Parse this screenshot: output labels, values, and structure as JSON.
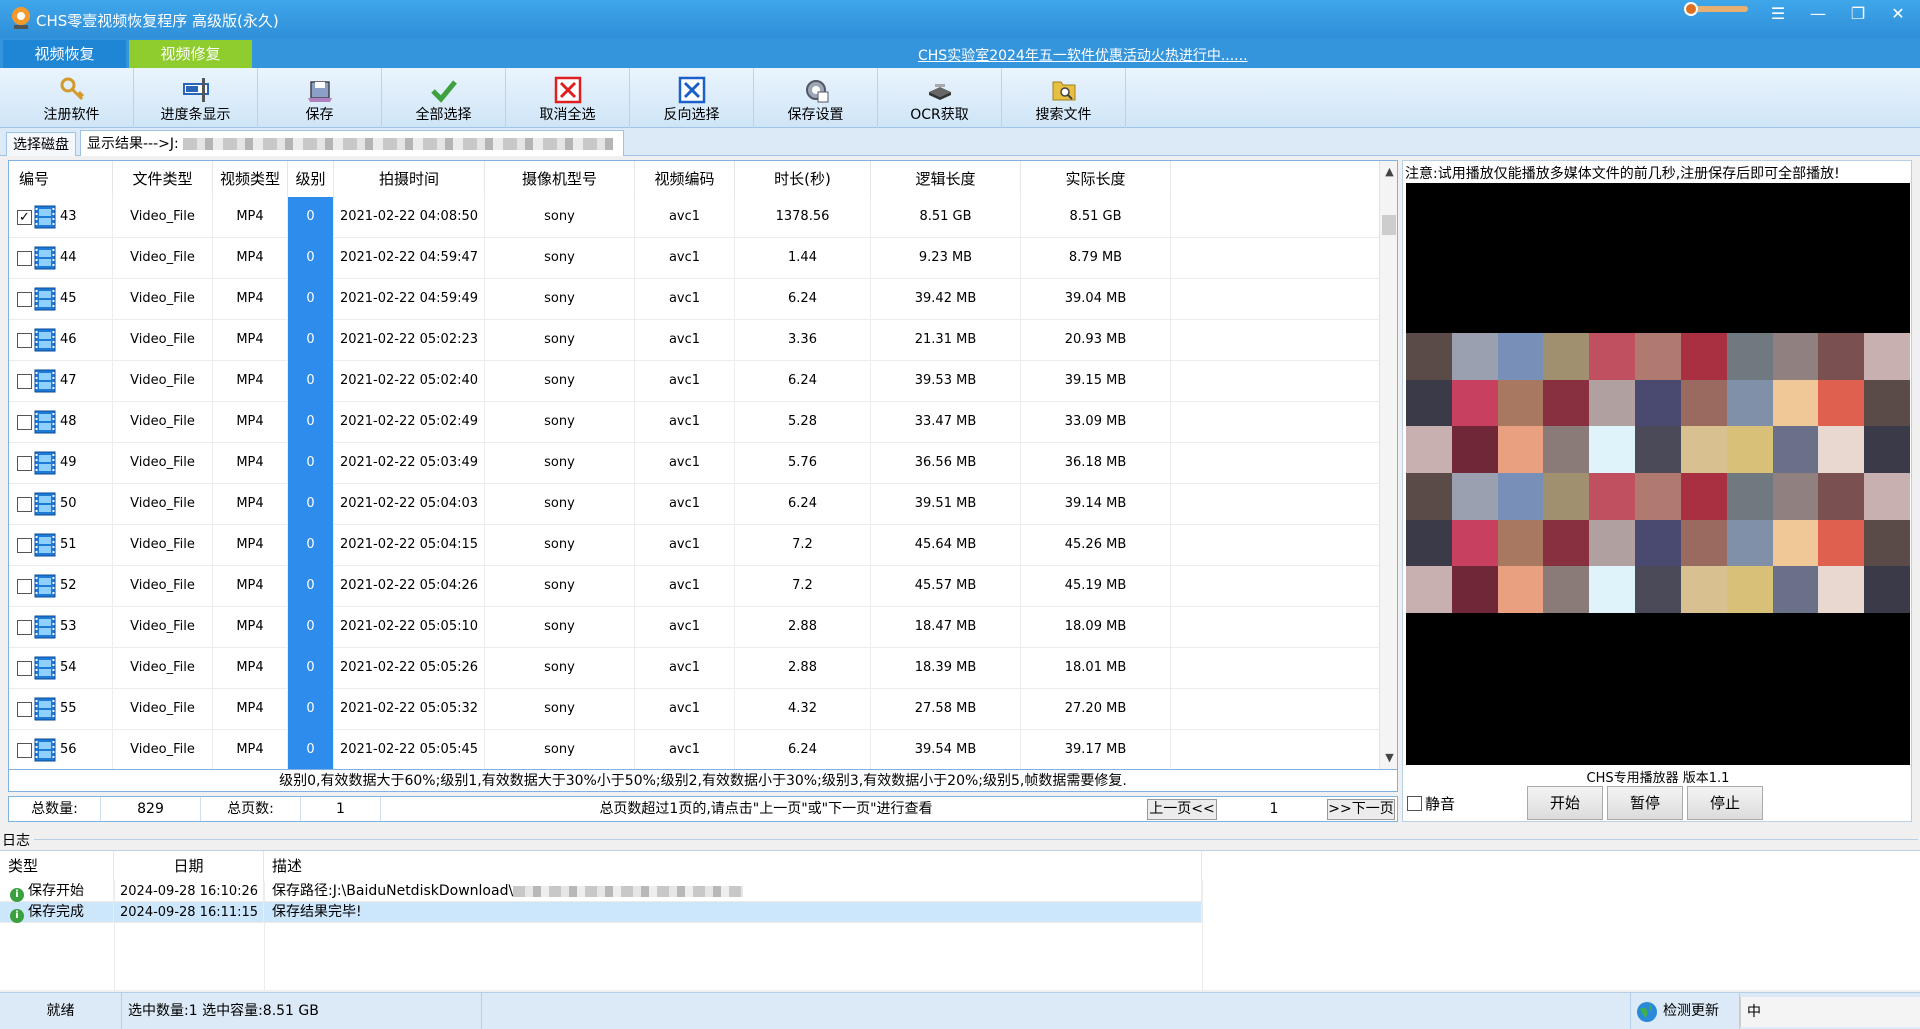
{
  "window": {
    "title": "CHS零壹视频恢复程序 高级版(永久)",
    "controls": [
      "☰",
      "—",
      "❐",
      "✕"
    ]
  },
  "tabs": {
    "recover": "视频恢复",
    "repair": "视频修复",
    "promo": "CHS实验室2024年五一软件优惠活动火热进行中......"
  },
  "toolbar": [
    {
      "label": "注册软件",
      "icon": "key-icon"
    },
    {
      "label": "进度条显示",
      "icon": "progressbar-icon"
    },
    {
      "label": "保存",
      "icon": "save-icon"
    },
    {
      "label": "全部选择",
      "icon": "check-icon"
    },
    {
      "label": "取消全选",
      "icon": "red-x-icon"
    },
    {
      "label": "反向选择",
      "icon": "blue-x-icon"
    },
    {
      "label": "保存设置",
      "icon": "settings-icon"
    },
    {
      "label": "OCR获取",
      "icon": "scanner-icon"
    },
    {
      "label": "搜索文件",
      "icon": "folder-search-icon"
    }
  ],
  "disk_tabs": {
    "select": "选择磁盘",
    "result": "显示结果--->J:"
  },
  "table": {
    "headers": [
      "编号",
      "文件类型",
      "视频类型",
      "级别",
      "拍摄时间",
      "摄像机型号",
      "视频编码",
      "时长(秒)",
      "逻辑长度",
      "实际长度"
    ],
    "rows": [
      {
        "id": "43",
        "checked": true,
        "ftype": "Video_File",
        "vtype": "MP4",
        "level": "0",
        "time": "2021-02-22 04:08:50",
        "camera": "sony",
        "codec": "avc1",
        "duration": "1378.56",
        "logical": "8.51 GB",
        "actual": "8.51 GB"
      },
      {
        "id": "44",
        "checked": false,
        "ftype": "Video_File",
        "vtype": "MP4",
        "level": "0",
        "time": "2021-02-22 04:59:47",
        "camera": "sony",
        "codec": "avc1",
        "duration": "1.44",
        "logical": "9.23 MB",
        "actual": "8.79 MB"
      },
      {
        "id": "45",
        "checked": false,
        "ftype": "Video_File",
        "vtype": "MP4",
        "level": "0",
        "time": "2021-02-22 04:59:49",
        "camera": "sony",
        "codec": "avc1",
        "duration": "6.24",
        "logical": "39.42 MB",
        "actual": "39.04 MB"
      },
      {
        "id": "46",
        "checked": false,
        "ftype": "Video_File",
        "vtype": "MP4",
        "level": "0",
        "time": "2021-02-22 05:02:23",
        "camera": "sony",
        "codec": "avc1",
        "duration": "3.36",
        "logical": "21.31 MB",
        "actual": "20.93 MB"
      },
      {
        "id": "47",
        "checked": false,
        "ftype": "Video_File",
        "vtype": "MP4",
        "level": "0",
        "time": "2021-02-22 05:02:40",
        "camera": "sony",
        "codec": "avc1",
        "duration": "6.24",
        "logical": "39.53 MB",
        "actual": "39.15 MB"
      },
      {
        "id": "48",
        "checked": false,
        "ftype": "Video_File",
        "vtype": "MP4",
        "level": "0",
        "time": "2021-02-22 05:02:49",
        "camera": "sony",
        "codec": "avc1",
        "duration": "5.28",
        "logical": "33.47 MB",
        "actual": "33.09 MB"
      },
      {
        "id": "49",
        "checked": false,
        "ftype": "Video_File",
        "vtype": "MP4",
        "level": "0",
        "time": "2021-02-22 05:03:49",
        "camera": "sony",
        "codec": "avc1",
        "duration": "5.76",
        "logical": "36.56 MB",
        "actual": "36.18 MB"
      },
      {
        "id": "50",
        "checked": false,
        "ftype": "Video_File",
        "vtype": "MP4",
        "level": "0",
        "time": "2021-02-22 05:04:03",
        "camera": "sony",
        "codec": "avc1",
        "duration": "6.24",
        "logical": "39.51 MB",
        "actual": "39.14 MB"
      },
      {
        "id": "51",
        "checked": false,
        "ftype": "Video_File",
        "vtype": "MP4",
        "level": "0",
        "time": "2021-02-22 05:04:15",
        "camera": "sony",
        "codec": "avc1",
        "duration": "7.2",
        "logical": "45.64 MB",
        "actual": "45.26 MB"
      },
      {
        "id": "52",
        "checked": false,
        "ftype": "Video_File",
        "vtype": "MP4",
        "level": "0",
        "time": "2021-02-22 05:04:26",
        "camera": "sony",
        "codec": "avc1",
        "duration": "7.2",
        "logical": "45.57 MB",
        "actual": "45.19 MB"
      },
      {
        "id": "53",
        "checked": false,
        "ftype": "Video_File",
        "vtype": "MP4",
        "level": "0",
        "time": "2021-02-22 05:05:10",
        "camera": "sony",
        "codec": "avc1",
        "duration": "2.88",
        "logical": "18.47 MB",
        "actual": "18.09 MB"
      },
      {
        "id": "54",
        "checked": false,
        "ftype": "Video_File",
        "vtype": "MP4",
        "level": "0",
        "time": "2021-02-22 05:05:26",
        "camera": "sony",
        "codec": "avc1",
        "duration": "2.88",
        "logical": "18.39 MB",
        "actual": "18.01 MB"
      },
      {
        "id": "55",
        "checked": false,
        "ftype": "Video_File",
        "vtype": "MP4",
        "level": "0",
        "time": "2021-02-22 05:05:32",
        "camera": "sony",
        "codec": "avc1",
        "duration": "4.32",
        "logical": "27.58 MB",
        "actual": "27.20 MB"
      },
      {
        "id": "56",
        "checked": false,
        "ftype": "Video_File",
        "vtype": "MP4",
        "level": "0",
        "time": "2021-02-22 05:05:45",
        "camera": "sony",
        "codec": "avc1",
        "duration": "6.24",
        "logical": "39.54 MB",
        "actual": "39.17 MB"
      }
    ]
  },
  "legend": "级别0,有效数据大于60%;级别1,有效数据大于30%小于50%;级别2,有效数据小于30%;级别3,有效数据小于20%;级别5,帧数据需要修复.",
  "pager": {
    "total_label": "总数量:",
    "total": "829",
    "pages_label": "总页数:",
    "pages": "1",
    "hint": "总页数超过1页的,请点击\"上一页\"或\"下一页\"进行查看",
    "prev": "上一页<<",
    "current": "1",
    "next": ">>下一页"
  },
  "player": {
    "note": "注意:试用播放仅能播放多媒体文件的前几秒,注册保存后即可全部播放!",
    "name": "CHS专用播放器 版本1.1",
    "mute": "静音",
    "start": "开始",
    "pause": "暂停",
    "stop": "停止"
  },
  "log": {
    "label": "日志",
    "headers": [
      "类型",
      "日期",
      "描述"
    ],
    "rows": [
      {
        "type": "保存开始",
        "date": "2024-09-28 16:10:26",
        "desc": "保存路径:J:\\BaiduNetdiskDownload\\"
      },
      {
        "type": "保存完成",
        "date": "2024-09-28 16:11:15",
        "desc": "保存结果完毕!"
      }
    ]
  },
  "status": {
    "ready": "就绪",
    "selection": "选中数量:1 选中容量:8.51 GB",
    "update": "检测更新",
    "tray": "中"
  },
  "colors": {
    "titlebar": "#3fa6ea",
    "accent": "#2e8cec",
    "repair_tab": "#8fcc2e"
  }
}
